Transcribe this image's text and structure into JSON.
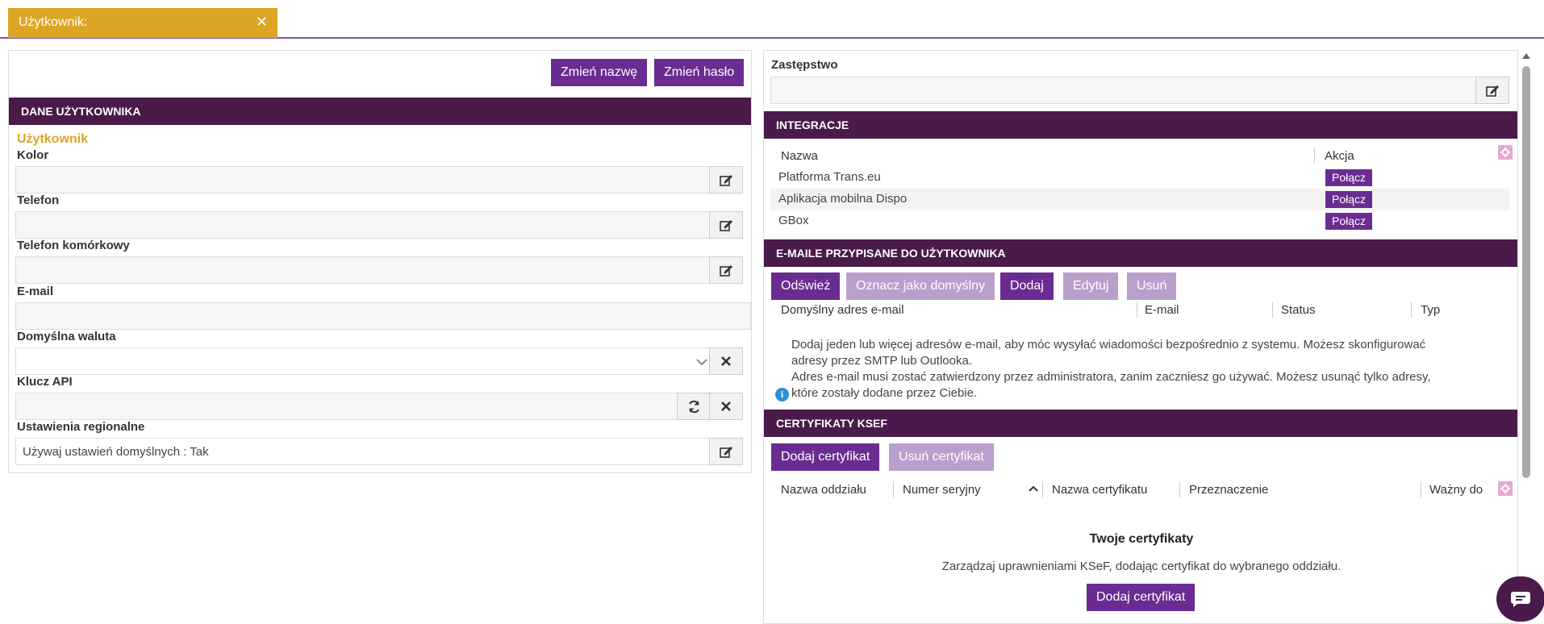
{
  "tab": {
    "title": "Użytkownik:",
    "close_icon": "close-icon"
  },
  "left": {
    "rename_button": "Zmień nazwę",
    "change_password_button": "Zmień hasło",
    "section_title": "DANE UŻYTKOWNIKA",
    "user_heading": "Użytkownik",
    "fields": {
      "color": {
        "label": "Kolor",
        "value": ""
      },
      "phone": {
        "label": "Telefon",
        "value": ""
      },
      "mobile": {
        "label": "Telefon komórkowy",
        "value": ""
      },
      "email": {
        "label": "E-mail",
        "value": ""
      },
      "currency": {
        "label": "Domyślna waluta",
        "value": ""
      },
      "api_key": {
        "label": "Klucz API",
        "value": ""
      },
      "regional": {
        "label": "Ustawienia regionalne",
        "value": "Używaj ustawień domyślnych : Tak"
      }
    }
  },
  "right": {
    "substitution": {
      "label": "Zastępstwo",
      "value": ""
    },
    "integrations": {
      "title": "INTEGRACJE",
      "col_name": "Nazwa",
      "col_action": "Akcja",
      "rows": [
        {
          "name": "Platforma Trans.eu",
          "action": "Połącz"
        },
        {
          "name": "Aplikacja mobilna Dispo",
          "action": "Połącz"
        },
        {
          "name": "GBox",
          "action": "Połącz"
        }
      ]
    },
    "emails": {
      "title": "E-MAILE PRZYPISANE DO UŻYTKOWNIKA",
      "buttons": {
        "refresh": "Odśwież",
        "set_default": "Oznacz jako domyślny",
        "add": "Dodaj",
        "edit": "Edytuj",
        "remove": "Usuń"
      },
      "columns": {
        "default": "Domyślny adres e-mail",
        "email": "E-mail",
        "status": "Status",
        "type": "Typ"
      },
      "info_line1": "Dodaj jeden lub więcej adresów e-mail, aby móc wysyłać wiadomości bezpośrednio z systemu. Możesz skonfigurować",
      "info_line2": "adresy przez SMTP lub Outlooka.",
      "info_line3": "Adres e-mail musi zostać zatwierdzony przez administratora, zanim zaczniesz go używać. Możesz usunąć tylko adresy,",
      "info_line4": "które zostały dodane przez Ciebie."
    },
    "ksef": {
      "title": "CERTYFIKATY KSEF",
      "add_button": "Dodaj certyfikat",
      "remove_button": "Usuń certyfikat",
      "columns": {
        "branch": "Nazwa oddziału",
        "serial": "Numer seryjny",
        "cert_name": "Nazwa certyfikatu",
        "purpose": "Przeznaczenie",
        "valid_to": "Ważny do"
      },
      "empty_title": "Twoje certyfikaty",
      "empty_text": "Zarządzaj uprawnieniami KSeF, dodając certyfikat do wybranego oddziału.",
      "empty_button": "Dodaj certyfikat"
    }
  },
  "colors": {
    "accent_purple": "#6a2c91",
    "header_dark": "#4a1a4a",
    "tab_gold": "#dda525",
    "light_purple": "#b99fcc"
  }
}
